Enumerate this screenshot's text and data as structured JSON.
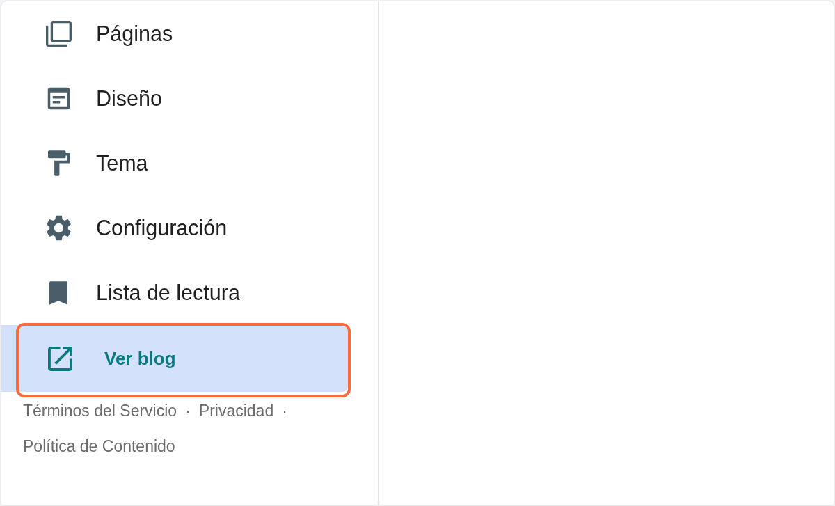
{
  "sidebar": {
    "items": [
      {
        "label": "Páginas",
        "selected": false,
        "highlighted": false
      },
      {
        "label": "Diseño",
        "selected": false,
        "highlighted": false
      },
      {
        "label": "Tema",
        "selected": false,
        "highlighted": false
      },
      {
        "label": "Configuración",
        "selected": false,
        "highlighted": false
      },
      {
        "label": "Lista de lectura",
        "selected": false,
        "highlighted": false
      },
      {
        "label": "Ver blog",
        "selected": true,
        "highlighted": true
      }
    ]
  },
  "footer": {
    "items": [
      {
        "kind": "link",
        "text": "Términos del Servicio"
      },
      {
        "kind": "separator",
        "text": "·"
      },
      {
        "kind": "link",
        "text": "Privacidad"
      },
      {
        "kind": "separator",
        "text": "·"
      },
      {
        "kind": "link",
        "text": "Política de Contenido"
      }
    ]
  }
}
